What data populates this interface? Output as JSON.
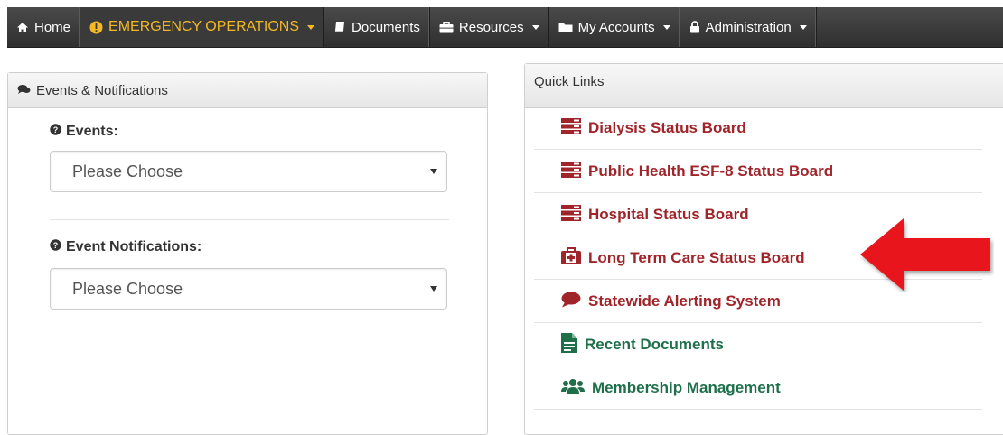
{
  "nav": {
    "items": [
      {
        "label": "Home",
        "icon": "home-icon"
      },
      {
        "label": "EMERGENCY OPERATIONS",
        "icon": "alert-circle-icon",
        "dropdown": true,
        "active": true
      },
      {
        "label": "Documents",
        "icon": "book-icon"
      },
      {
        "label": "Resources",
        "icon": "briefcase-icon",
        "dropdown": true
      },
      {
        "label": "My Accounts",
        "icon": "folder-icon",
        "dropdown": true
      },
      {
        "label": "Administration",
        "icon": "lock-icon",
        "dropdown": true
      }
    ]
  },
  "events_panel": {
    "title": "Events & Notifications",
    "events_label": "Events:",
    "events_select": "Please Choose",
    "notifications_label": "Event Notifications:",
    "notifications_select": "Please Choose"
  },
  "quick_links": {
    "title": "Quick Links",
    "items": [
      {
        "label": "Dialysis Status Board",
        "icon": "server-icon",
        "color": "#a0252a"
      },
      {
        "label": "Public Health ESF-8 Status Board",
        "icon": "server-icon",
        "color": "#a0252a"
      },
      {
        "label": "Hospital Status Board",
        "icon": "server-icon",
        "color": "#a0252a"
      },
      {
        "label": "Long Term Care Status Board",
        "icon": "medkit-icon",
        "color": "#a0252a"
      },
      {
        "label": "Statewide Alerting System",
        "icon": "comment-icon",
        "color": "#a0252a"
      },
      {
        "label": "Recent Documents",
        "icon": "file-text-icon",
        "color": "#1e6f4a"
      },
      {
        "label": "Membership Management",
        "icon": "users-icon",
        "color": "#1e6f4a"
      }
    ]
  },
  "colors": {
    "nav_bg": "#3a3a3a",
    "nav_active": "#f4b824",
    "link_red": "#a0252a",
    "link_green": "#1e6f4a",
    "annotation_arrow": "#e8141b"
  }
}
